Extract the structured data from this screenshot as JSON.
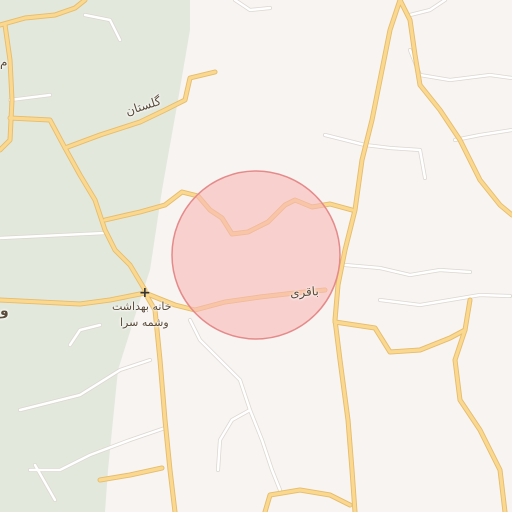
{
  "map": {
    "colors": {
      "land": "#f7f4f1",
      "forest": "#e3e8dc",
      "road_main": "#f7d58b",
      "road_main_casing": "#e9bb5f",
      "road_minor": "#ffffff",
      "road_minor_casing": "#d9d4cf",
      "highlight_fill": "#f9c4c4",
      "highlight_stroke": "#e88c8c"
    },
    "labels": {
      "road_golestan": "گلستان",
      "road_baqari": "باقری",
      "poi_line1": "خانه بهداشت",
      "poi_line2": "وشمه سرا",
      "edge_left_1": "م",
      "edge_left_2": "و"
    },
    "icons": {
      "poi": "health-cross-icon",
      "poi_glyph": "+"
    }
  }
}
